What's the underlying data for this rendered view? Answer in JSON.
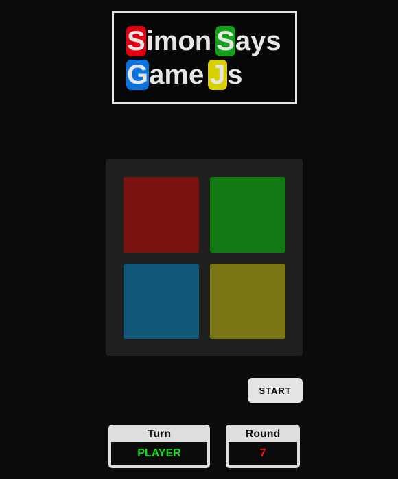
{
  "title": {
    "line1": {
      "badge1": "S",
      "text1": "imon",
      "badge2": "S",
      "text2": "ays"
    },
    "line2": {
      "badge1": "G",
      "text1": "ame",
      "badge2": "J",
      "text2": "s"
    }
  },
  "colors": {
    "badge_red": "#e1000f",
    "badge_green": "#11a018",
    "badge_blue": "#0a73e0",
    "badge_yellow": "#d8d000",
    "pad_red": "#7a1212",
    "pad_green": "#137a13",
    "pad_blue": "#125678",
    "pad_yellow": "#7a7613",
    "turn_value": "#11e21b",
    "round_value": "#ff1010"
  },
  "board": {
    "pads": [
      "red-pad",
      "green-pad",
      "blue-pad",
      "yellow-pad"
    ]
  },
  "controls": {
    "start_label": "START"
  },
  "status": {
    "turn_label": "Turn",
    "turn_value": "PLAYER",
    "round_label": "Round",
    "round_value": "7"
  }
}
